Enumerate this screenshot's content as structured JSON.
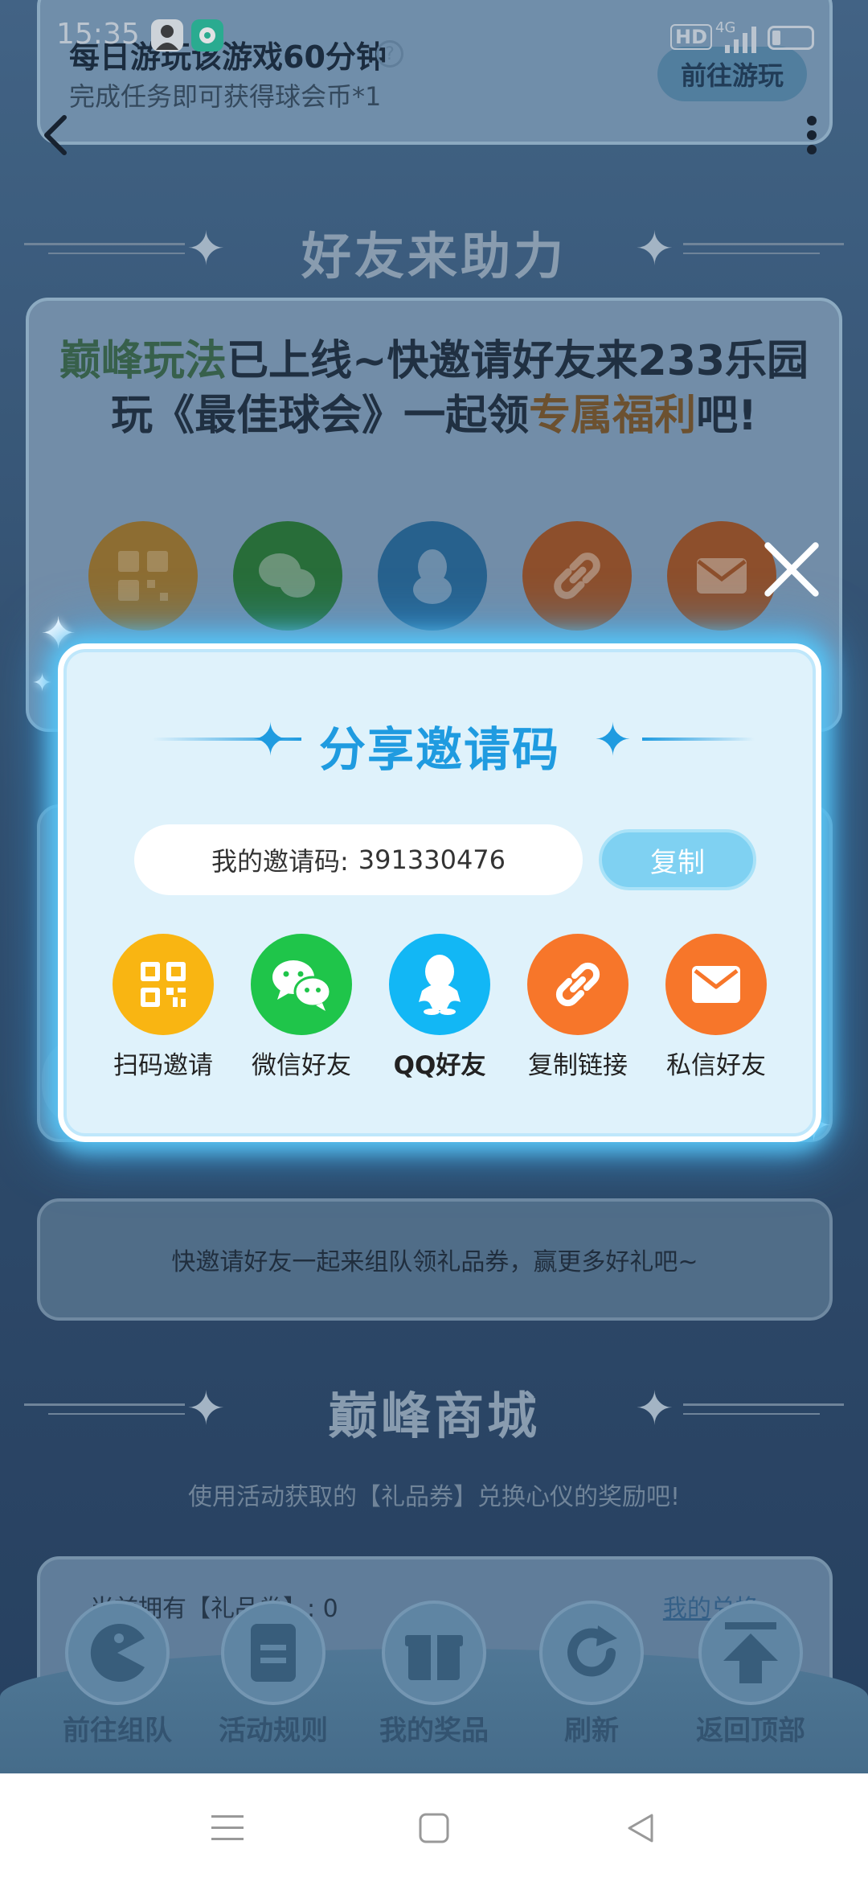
{
  "status_bar": {
    "time": "15:35",
    "hd": "HD",
    "network": "4G"
  },
  "task": {
    "title": "每日游玩该游戏60分钟",
    "subtitle": "完成任务即可获得球会币*1",
    "button": "前往游玩"
  },
  "friends_section": {
    "title": "好友来助力",
    "promo_part1": "巅峰玩法",
    "promo_part2": "已上线~快邀请好友来233乐园玩《最佳球会》一起领",
    "promo_part3": "专属福利",
    "promo_part4": "吧!"
  },
  "modal": {
    "title": "分享邀请码",
    "code_label": "我的邀请码:",
    "code_value": "391330476",
    "copy_label": "复制",
    "share_options": [
      {
        "label": "扫码邀请",
        "icon": "qr-code-icon",
        "color": "#f9b512"
      },
      {
        "label": "微信好友",
        "icon": "wechat-icon",
        "color": "#1fc54a"
      },
      {
        "label": "QQ好友",
        "icon": "qq-penguin-icon",
        "color": "#12b7f5"
      },
      {
        "label": "复制链接",
        "icon": "link-icon",
        "color": "#f7762a"
      },
      {
        "label": "私信好友",
        "icon": "mail-icon",
        "color": "#f7762a"
      }
    ]
  },
  "tip": "快邀请好友一起来组队领礼品券，赢更多好礼吧~",
  "mall": {
    "title": "巅峰商城",
    "subtitle": "使用活动获取的【礼品券】兑换心仪的奖励吧!",
    "owned_label": "当前拥有【礼品券】: 0",
    "exchange_link": "我的兑换>"
  },
  "dock": [
    {
      "label": "前往组队",
      "icon": "pacman-icon"
    },
    {
      "label": "活动规则",
      "icon": "document-icon"
    },
    {
      "label": "我的奖品",
      "icon": "gift-icon"
    },
    {
      "label": "刷新",
      "icon": "refresh-icon"
    },
    {
      "label": "返回顶部",
      "icon": "back-to-top-icon"
    }
  ],
  "colors": {
    "accent": "#1f9be0",
    "modal_bg": "#dff2fb",
    "glow": "#58c6f6"
  }
}
